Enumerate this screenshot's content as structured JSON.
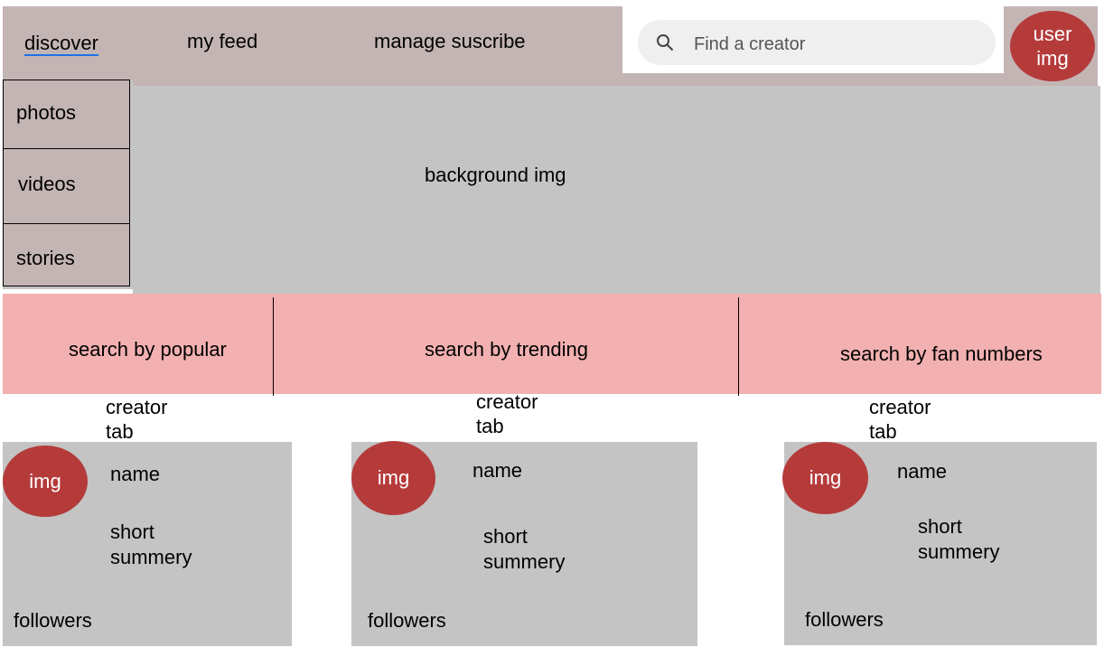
{
  "nav": {
    "discover": "discover",
    "my_feed": "my feed",
    "manage": "manage suscribe"
  },
  "search": {
    "placeholder": "Find a creator",
    "icon": "search-icon"
  },
  "user_avatar": {
    "line1": "user",
    "line2": "img"
  },
  "hero": {
    "label": "background img"
  },
  "side_menu": {
    "items": [
      "photos",
      "videos",
      "stories"
    ]
  },
  "filters": [
    "search by popular",
    "search by trending",
    "search by fan numbers"
  ],
  "creator_tab": {
    "line1": "creator",
    "line2": "tab"
  },
  "cards": [
    {
      "img": "img",
      "name": "name",
      "summary_line1": "short",
      "summary_line2": "summery",
      "followers": "followers"
    },
    {
      "img": "img",
      "name": "name",
      "summary_line1": "short",
      "summary_line2": "summery",
      "followers": "followers"
    },
    {
      "img": "img",
      "name": "name",
      "summary_line1": "short",
      "summary_line2": "summery",
      "followers": "followers"
    }
  ],
  "colors": {
    "topbar": "#c4b5b5",
    "placeholder": "#c4c4c4",
    "filters": "#f2b0b0",
    "avatar": "#b53b3b",
    "link_underline": "#1a73e8"
  }
}
